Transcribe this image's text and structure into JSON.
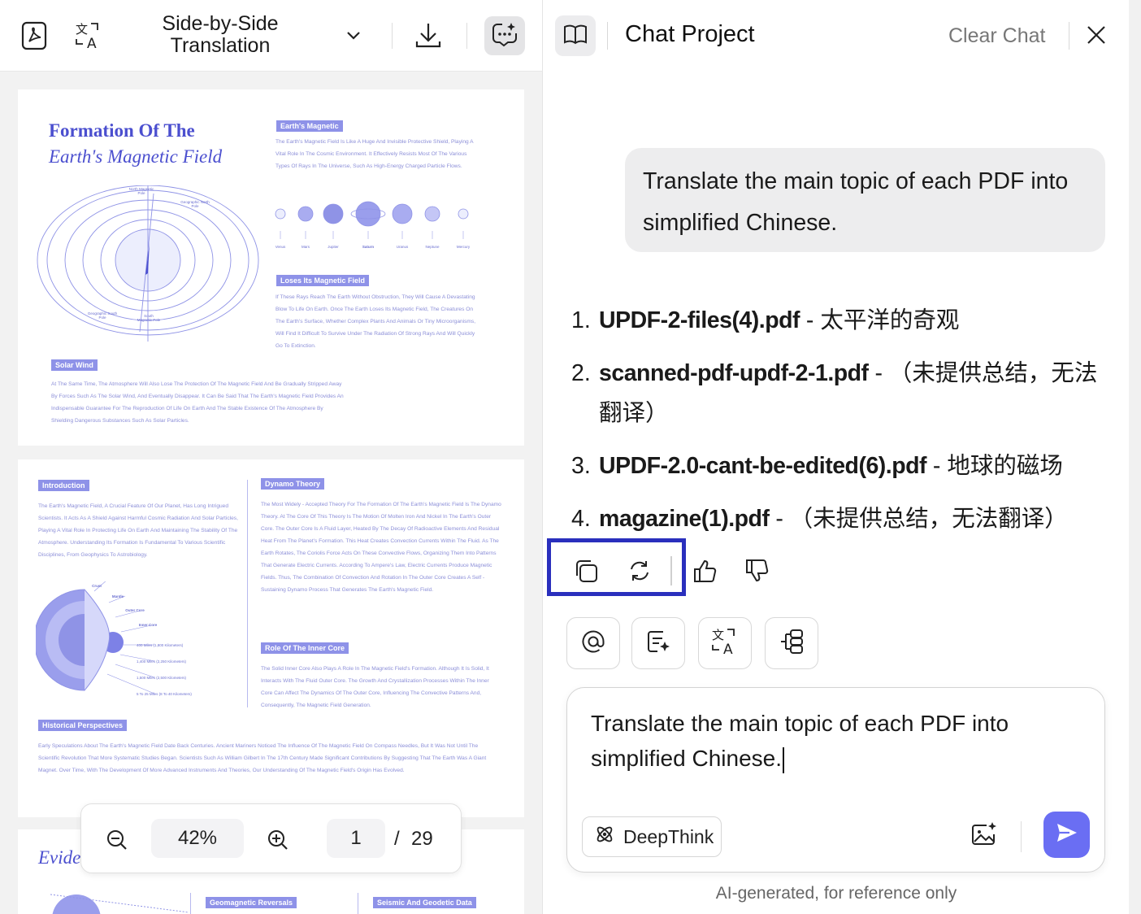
{
  "toolbar": {
    "mode_title_line1": "Side-by-Side",
    "mode_title_line2": "Translation",
    "icons": [
      "pdf-icon",
      "translate-icon",
      "chevron-down-icon",
      "download-icon",
      "ai-chat-icon"
    ]
  },
  "document": {
    "page1": {
      "title_line1": "Formation Of The",
      "title_line2": "Earth's Magnetic Field",
      "tag_magnetic": "Earth's Magnetic",
      "para_magnetic": "The Earth's Magnetic Field Is Like A Huge And Invisible Protective Shield, Playing A Vital Role In The Cosmic Environment. It Effectively Resists Most Of The Various Types Of Rays In The Universe, Such As High-Energy Charged Particle Flows.",
      "label_north_magnetic": "North Magnetic Pole",
      "label_geographic_north": "Geographic North Pole",
      "label_geographic_south": "Geographic South Pole",
      "label_south_magnetic": "South Magnetic Pole",
      "planets": [
        "Venus",
        "Mars",
        "Jupiter",
        "Saturn",
        "Uranus",
        "Neptune",
        "Mercury"
      ],
      "tag_loses": "Loses Its Magnetic Field",
      "para_loses": "If These Rays Reach The Earth Without Obstruction, They Will Cause A Devastating Blow To Life On Earth. Once The Earth Loses Its Magnetic Field, The Creatures On The Earth's Surface, Whether Complex Plants And Animals Or Tiny Microorganisms, Will Find It Difficult To Survive Under The Radiation Of Strong Rays And Will Quickly Go To Extinction.",
      "tag_solar": "Solar Wind",
      "para_solar": "At The Same Time, The Atmosphere Will Also Lose The Protection Of The Magnetic Field And Be Gradually Stripped Away By Forces Such As The Solar Wind, And Eventually Disappear. It Can Be Said That The Earth's Magnetic Field Provides An Indispensable Guarantee For The Reproduction Of Life On Earth And The Stable Existence Of The Atmosphere By Shielding Dangerous Substances Such As Solar Particles."
    },
    "page2": {
      "tag_intro": "Introduction",
      "para_intro": "The Earth's Magnetic Field, A Crucial Feature Of Our Planet, Has Long Intrigued Scientists. It Acts As A Shield Against Harmful Cosmic Radiation And Solar Particles, Playing A Vital Role In Protecting Life On Earth And Maintaining The Stability Of The Atmosphere. Understanding Its Formation Is Fundamental To Various Scientific Disciplines, From Geophysics To Astrobiology.",
      "layers": [
        "Crust",
        "Mantle",
        "Outer Core",
        "Inner Core"
      ],
      "depths": [
        "400 Miles (1,800 Kilometers)",
        "1,400 Miles (2,250 Kilometers)",
        "1,500 Miles (2,500 Kilometers)",
        "5 To 25 Miles (8 To 40 Kilometers)"
      ],
      "tag_dynamo": "Dynamo Theory",
      "para_dynamo": "The Most Widely - Accepted Theory For The Formation Of The Earth's Magnetic Field Is The Dynamo Theory. At The Core Of This Theory Is The Motion Of Molten Iron And Nickel In The Earth's Outer Core. The Outer Core Is A Fluid Layer, Heated By The Decay Of Radioactive Elements And Residual Heat From The Planet's Formation. This Heat Creates Convection Currents Within The Fluid. As The Earth Rotates, The Coriolis Force Acts On These Convective Flows, Organizing Them Into Patterns That Generate Electric Currents. According To Ampere's Law, Electric Currents Produce Magnetic Fields. Thus, The Combination Of Convection And Rotation In The Outer Core Creates A Self - Sustaining Dynamo Process That Generates The Earth's Magnetic Field.",
      "tag_inner": "Role Of The Inner Core",
      "para_inner": "The Solid Inner Core Also Plays A Role In The Magnetic Field's Formation. Although It Is Solid, It Interacts With The Fluid Outer Core. The Growth And Crystallization Processes Within The Inner Core Can Affect The Dynamics Of The Outer Core, Influencing The Convective Patterns And, Consequently, The Magnetic Field Generation.",
      "tag_history": "Historical Perspectives",
      "para_history": "Early Speculations About The Earth's Magnetic Field Date Back Centuries. Ancient Mariners Noticed The Influence Of The Magnetic Field On Compass Needles, But It Was Not Until The Scientific Revolution That More Systematic Studies Began. Scientists Such As William Gilbert In The 17th Century Made Significant Contributions By Suggesting That The Earth Was A Giant Magnet. Over Time, With The Development Of More Advanced Instruments And Theories, Our Understanding Of The Magnetic Field's Origin Has Evolved."
    },
    "page3": {
      "title_partial": "Evide",
      "tag_reversals": "Geomagnetic Reversals",
      "tag_seismic": "Seismic And Geodetic Data"
    }
  },
  "zoom": {
    "level": "42%",
    "current_page": "1",
    "separator": "/",
    "total_pages": "29"
  },
  "chat": {
    "title": "Chat Project",
    "clear_label": "Clear Chat",
    "user_message": "Translate the main topic of each PDF into simplified Chinese.",
    "answers": [
      {
        "num": "1.",
        "file": "UPDF-2-files(4).pdf",
        "sep": " - ",
        "text": "太平洋的奇观"
      },
      {
        "num": "2.",
        "file": "scanned-pdf-updf-2-1.pdf",
        "sep": " - ",
        "text": "（未提供总结，无法翻译）"
      },
      {
        "num": "3.",
        "file": "UPDF-2.0-cant-be-edited(6).pdf",
        "sep": " - ",
        "text": "地球的磁场"
      },
      {
        "num": "4.",
        "file": "magazine(1).pdf",
        "sep": " - ",
        "text": "（未提供总结，无法翻译）"
      }
    ],
    "input_value": "Translate the main topic of each PDF into simplified Chinese.",
    "deepthink_label": "DeepThink",
    "footer_note": "AI-generated, for reference only",
    "accent_color": "#6a6ef3",
    "highlight_color": "#2a2fbd"
  }
}
